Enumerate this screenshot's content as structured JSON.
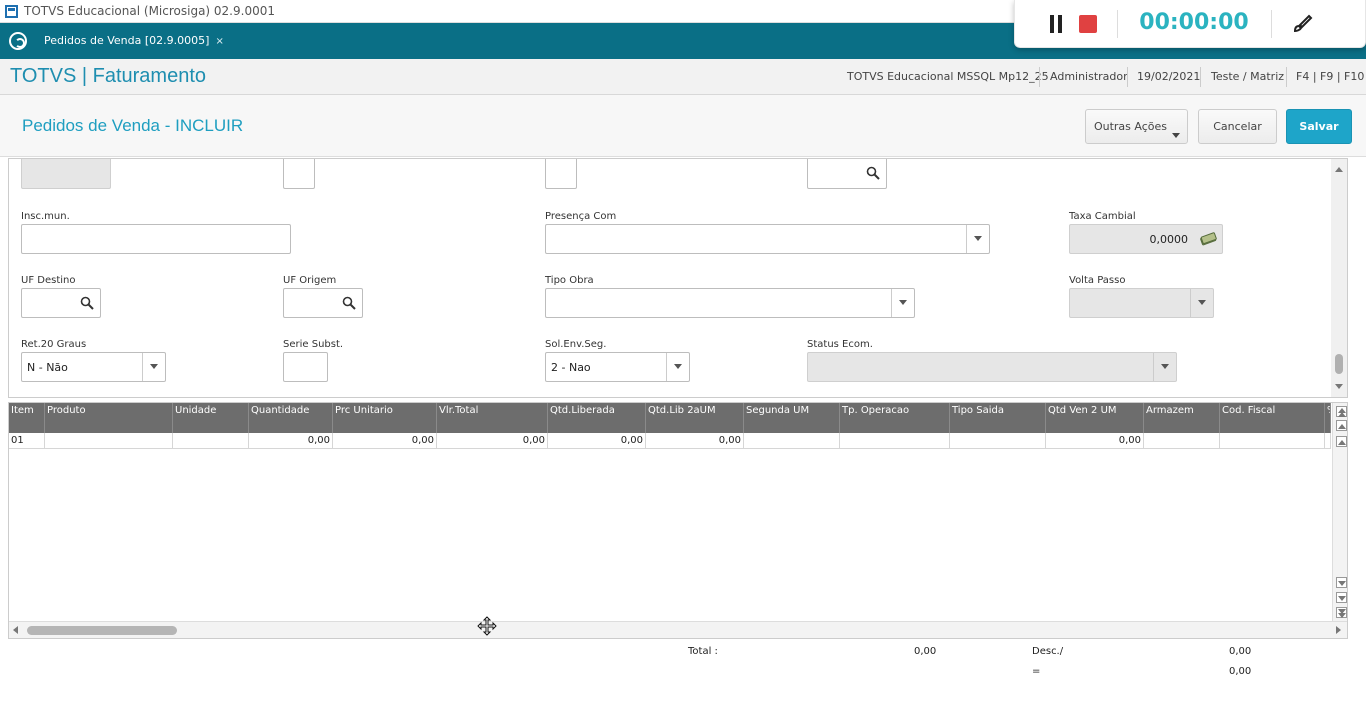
{
  "window": {
    "title": "TOTVS Educacional (Microsiga) 02.9.0001"
  },
  "recorder": {
    "time": "00:00:00",
    "pause_icon": "pause-icon",
    "stop_icon": "stop-icon",
    "brush_icon": "brush-icon"
  },
  "tabbar": {
    "tab_label": "Pedidos de Venda [02.9.0005]",
    "close": "×"
  },
  "header": {
    "brand": "TOTVS | Faturamento",
    "environment": "TOTVS Educacional MSSQL Mp12_25",
    "user": "Administrador",
    "date": "19/02/2021",
    "branch": "Teste / Matriz",
    "shortcuts": "F4 | F9 | F10"
  },
  "page": {
    "title": "Pedidos de Venda - INCLUIR",
    "buttons": {
      "other_actions": "Outras Ações",
      "cancel": "Cancelar",
      "save": "Salvar"
    }
  },
  "form": {
    "insc_mun": {
      "label": "Insc.mun.",
      "value": ""
    },
    "presenca_com": {
      "label": "Presença Com",
      "value": ""
    },
    "taxa_cambial": {
      "label": "Taxa Cambial",
      "value": "0,0000"
    },
    "uf_destino": {
      "label": "UF Destino",
      "value": ""
    },
    "uf_origem": {
      "label": "UF Origem",
      "value": ""
    },
    "tipo_obra": {
      "label": "Tipo Obra",
      "value": ""
    },
    "volta_passo": {
      "label": "Volta Passo",
      "value": ""
    },
    "ret_20_graus": {
      "label": "Ret.20 Graus",
      "value": "N - Não"
    },
    "serie_subst": {
      "label": "Serie Subst.",
      "value": ""
    },
    "sol_env_seg": {
      "label": "Sol.Env.Seg.",
      "value": "2 - Nao"
    },
    "status_ecom": {
      "label": "Status Ecom.",
      "value": ""
    }
  },
  "grid": {
    "columns": [
      "Item",
      "Produto",
      "Unidade",
      "Quantidade",
      "Prc Unitario",
      "Vlr.Total",
      "Qtd.Liberada",
      "Qtd.Lib 2aUM",
      "Segunda UM",
      "Tp. Operacao",
      "Tipo Saida",
      "Qtd Ven 2 UM",
      "Armazem",
      "Cod. Fiscal",
      "%"
    ],
    "rows": [
      [
        "01",
        "",
        "",
        "0,00",
        "0,00",
        "0,00",
        "0,00",
        "0,00",
        "",
        "",
        "",
        "0,00",
        "",
        "",
        ""
      ]
    ]
  },
  "totals": {
    "total_label": "Total :",
    "total_value": "0,00",
    "desc_label": "Desc./",
    "desc_value": "0,00",
    "eq_label": "=",
    "eq_value": "0,00"
  }
}
